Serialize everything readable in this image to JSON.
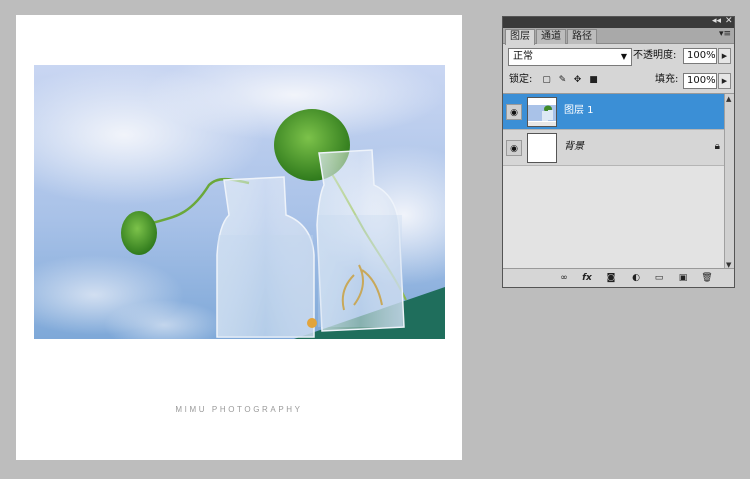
{
  "canvas": {
    "watermark": "MIMU PHOTOGRAPHY"
  },
  "panel": {
    "titlebar": {
      "collapse_icon": "◂◂",
      "close_icon": "✕"
    },
    "tabs": [
      {
        "label": "图层",
        "active": true
      },
      {
        "label": "通道",
        "active": false
      },
      {
        "label": "路径",
        "active": false
      }
    ],
    "menu_icon": "▾≡",
    "blend_mode": "正常",
    "opacity_label": "不透明度:",
    "opacity_value": "100%",
    "lock_label": "锁定:",
    "fill_label": "填充:",
    "fill_value": "100%",
    "layers": [
      {
        "name": "图层 1",
        "selected": true,
        "visible": true
      },
      {
        "name": "背景",
        "selected": false,
        "visible": true,
        "locked": true
      }
    ]
  },
  "colors": {
    "selection": "#3b8fd6",
    "background": "#bdbdbd"
  }
}
